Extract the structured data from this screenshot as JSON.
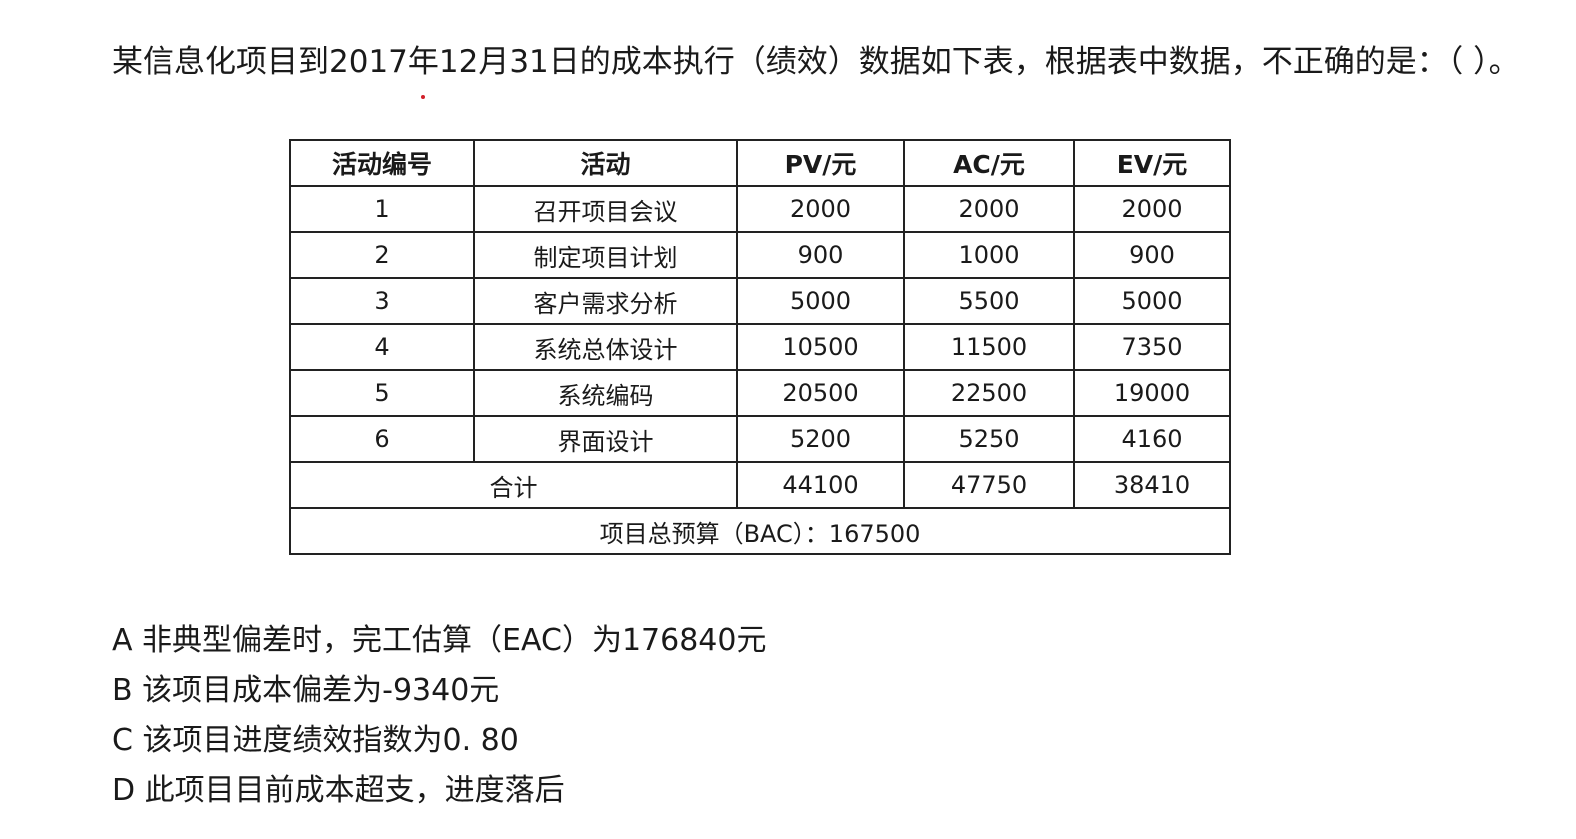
{
  "question": "某信息化项目到2017年12月31日的成本执行（绩效）数据如下表，根据表中数据，不正确的是：（ ）。",
  "table": {
    "headers": [
      "活动编号",
      "活动",
      "PV/元",
      "AC/元",
      "EV/元"
    ],
    "rows": [
      {
        "id": "1",
        "activity": "召开项目会议",
        "pv": "2000",
        "ac": "2000",
        "ev": "2000"
      },
      {
        "id": "2",
        "activity": "制定项目计划",
        "pv": "900",
        "ac": "1000",
        "ev": "900"
      },
      {
        "id": "3",
        "activity": "客户需求分析",
        "pv": "5000",
        "ac": "5500",
        "ev": "5000"
      },
      {
        "id": "4",
        "activity": "系统总体设计",
        "pv": "10500",
        "ac": "11500",
        "ev": "7350"
      },
      {
        "id": "5",
        "activity": "系统编码",
        "pv": "20500",
        "ac": "22500",
        "ev": "19000"
      },
      {
        "id": "6",
        "activity": "界面设计",
        "pv": "5200",
        "ac": "5250",
        "ev": "4160"
      }
    ],
    "total": {
      "label": "合计",
      "pv": "44100",
      "ac": "47750",
      "ev": "38410"
    },
    "budget": "项目总预算（BAC）：167500"
  },
  "options": [
    "A 非典型偏差时，完工估算（EAC）为176840元",
    "B 该项目成本偏差为-9340元",
    "C 该项目进度绩效指数为0. 80",
    "D 此项目目前成本超支，进度落后"
  ]
}
